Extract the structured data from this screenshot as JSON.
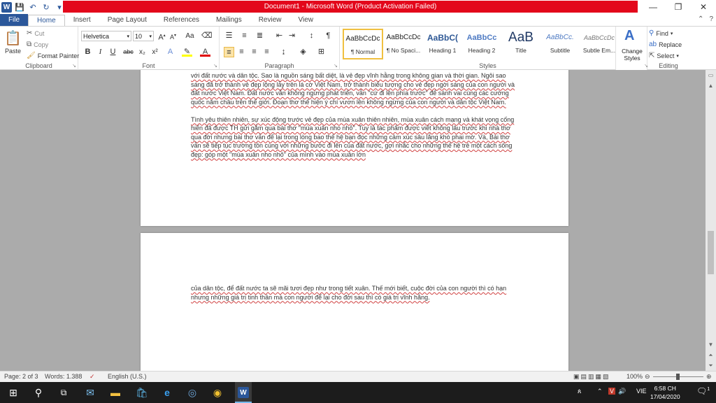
{
  "window": {
    "title": "Document1  -  Microsoft Word (Product Activation Failed)",
    "minimize": "—",
    "restore": "❐",
    "close": "✕"
  },
  "tabs": [
    "File",
    "Home",
    "Insert",
    "Page Layout",
    "References",
    "Mailings",
    "Review",
    "View"
  ],
  "active_tab": "Home",
  "clipboard": {
    "label": "Clipboard",
    "paste": "Paste",
    "cut": "Cut",
    "copy": "Copy",
    "format_painter": "Format Painter"
  },
  "font": {
    "label": "Font",
    "family": "Helvetica",
    "size": "10"
  },
  "paragraph": {
    "label": "Paragraph"
  },
  "styles": {
    "label": "Styles",
    "items": [
      {
        "preview": "AaBbCcDc",
        "name": "¶ Normal"
      },
      {
        "preview": "AaBbCcDc",
        "name": "¶ No Spaci..."
      },
      {
        "preview": "AaBbC(",
        "name": "Heading 1"
      },
      {
        "preview": "AaBbCc",
        "name": "Heading 2"
      },
      {
        "preview": "AaB",
        "name": "Title"
      },
      {
        "preview": "AaBbCc.",
        "name": "Subtitle"
      },
      {
        "preview": "AaBbCcDc",
        "name": "Subtle Em..."
      }
    ],
    "change_styles": "Change Styles"
  },
  "editing": {
    "label": "Editing",
    "find": "Find",
    "replace": "Replace",
    "select": "Select"
  },
  "document": {
    "page1_paragraphs": [
      "với đất nước và dân tộc. Sao là nguồn sáng bất diệt, là vẻ đẹp vĩnh hằng trong không gian và thời gian. Ngôi sao sáng đã trở thành vẻ đẹp lộng lẫy trên lá cờ Việt Nam, trở thành biểu tượng cho vẻ đẹp ngời sáng của con người và đất nước Việt Nam. Đất nước vẫn không ngừng phát triển, vẫn \"cứ đi lên phía trước\" để sánh vai cùng các cường quốc năm châu trên thế giới. Đoạn thơ thể hiện ý chí vươn lên không ngừng của con người và dân tộc Việt Nam.",
      "Tình yêu thiên nhiên, sự xúc động trước vẻ đẹp của mùa xuân thiên nhiên, mùa xuân cách mạng và khát vọng cống hiến đã được TH gửi gắm qua bài thơ \"mùa xuân nho nhỏ\". Tuy là tác phẩm được viết không lâu trước khi nhà thơ qua đời nhưng bài thơ vẫn để lại trong lòng bao thế hệ bạn đọc những cảm xúc sâu lắng khó phai mờ. Và, Bài thơ vẫn sẽ tiếp tục trường tồn cùng với những bước đi lên của đất nước, gợi nhắc cho những thế hệ trẻ một cách sống đẹp: góp một \"mùa xuân nho nhỏ\" của mình vào mùa xuân lớn"
    ],
    "page2_paragraphs": [
      "của dân tộc, để đất nước ta sẽ mãi tươi đẹp như trong tiết xuân. Thế mới biết, cuộc đời của con người thì có hạn nhưng những giá trị tinh thần mà con người để lại cho đời sau thì có giá trị vĩnh hằng."
    ]
  },
  "status": {
    "page": "Page: 2 of 3",
    "words": "Words: 1.388",
    "language": "English (U.S.)",
    "zoom": "100%",
    "zoom_level": 1.0
  },
  "taskbar": {
    "language": "VIE",
    "time": "6:58 CH",
    "date": "17/04/2020",
    "notifications": "1"
  }
}
